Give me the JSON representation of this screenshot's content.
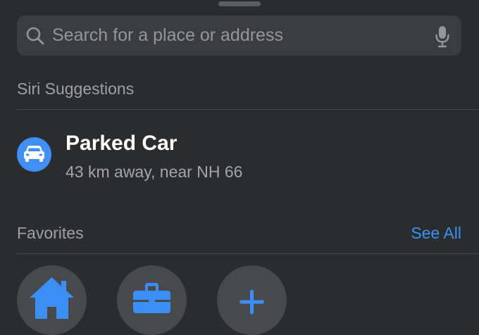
{
  "search": {
    "placeholder": "Search for a place or address",
    "value": ""
  },
  "siri_suggestions": {
    "header": "Siri Suggestions",
    "items": [
      {
        "icon": "car-icon",
        "title": "Parked Car",
        "subtitle": "43 km away, near NH 66"
      }
    ]
  },
  "favorites": {
    "header": "Favorites",
    "see_all_label": "See All",
    "items": [
      {
        "icon": "home-icon"
      },
      {
        "icon": "briefcase-icon"
      },
      {
        "icon": "plus-icon"
      }
    ]
  },
  "colors": {
    "background": "#2b2c2e",
    "accent": "#3b8ff4",
    "search_field": "#3c3d41",
    "secondary_text": "#9fa0a5"
  }
}
